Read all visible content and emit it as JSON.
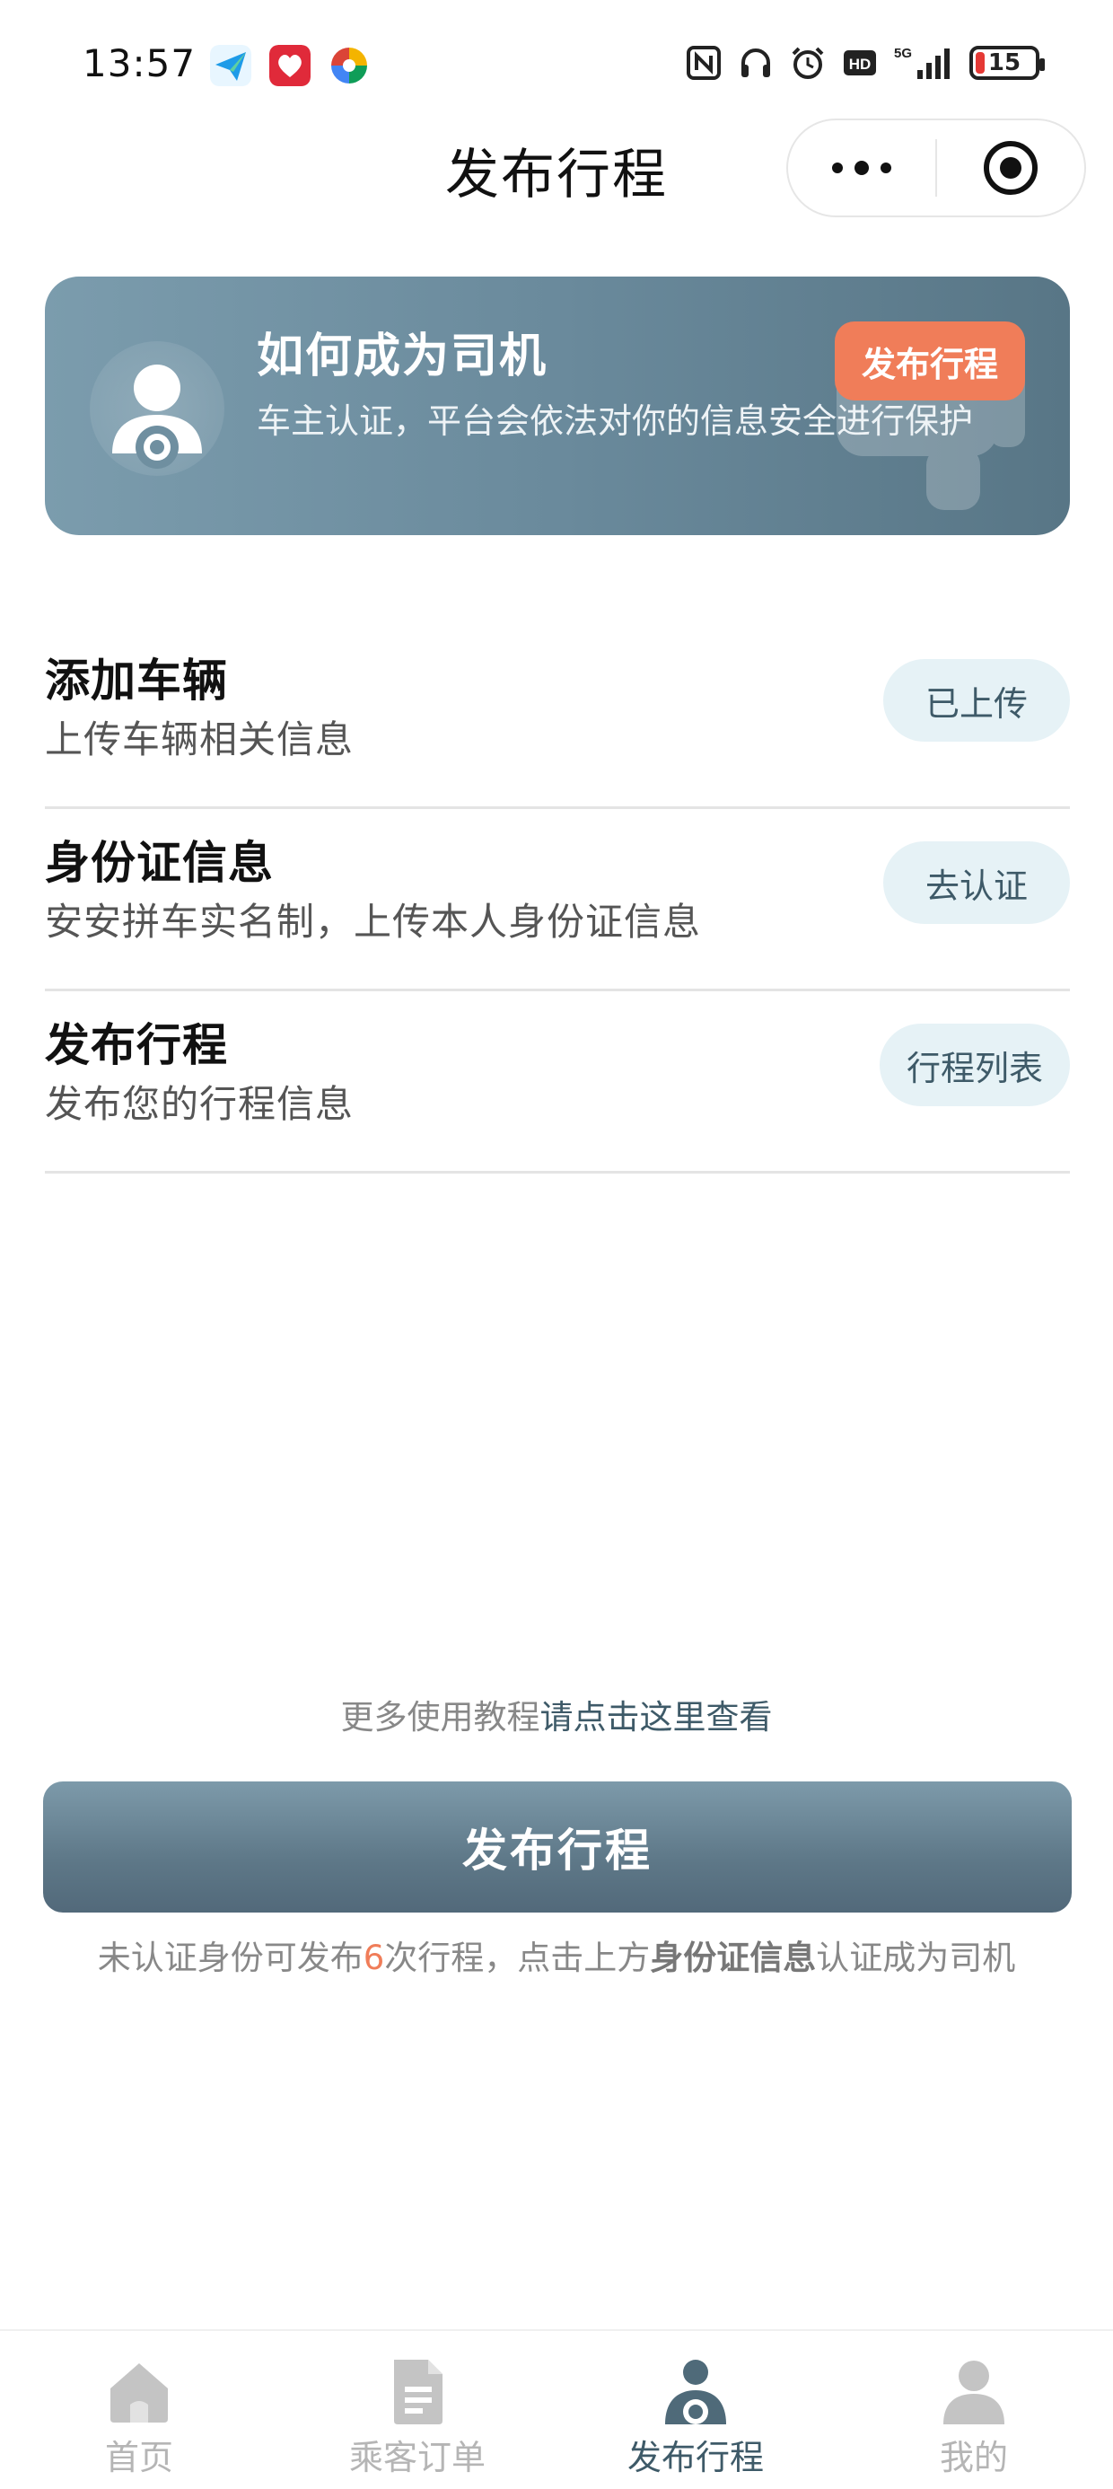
{
  "status_bar": {
    "time": "13:57",
    "battery": "15",
    "icons": [
      "nfc-icon",
      "headphones-icon",
      "alarm-icon",
      "hd-icon",
      "5g-signal-icon",
      "battery-icon"
    ]
  },
  "header": {
    "title": "发布行程"
  },
  "banner": {
    "title": "如何成为司机",
    "description": "车主认证，平台会依法对你的信息安全进行保护",
    "button_label": "发布行程"
  },
  "steps": [
    {
      "title": "添加车辆",
      "subtitle": "上传车辆相关信息",
      "action": "已上传"
    },
    {
      "title": "身份证信息",
      "subtitle": "安安拼车实名制，上传本人身份证信息",
      "action": "去认证"
    },
    {
      "title": "发布行程",
      "subtitle": "发布您的行程信息",
      "action": "行程列表"
    }
  ],
  "tutorial": {
    "prefix": "更多使用教程",
    "link": "请点击这里查看"
  },
  "publish_button": "发布行程",
  "notice": {
    "part1": "未认证身份可发布",
    "count": "6",
    "part2": "次行程，点击上方",
    "strong": "身份证信息",
    "part3": "认证成为司机"
  },
  "tabbar": {
    "items": [
      {
        "label": "首页",
        "icon": "home-icon",
        "active": false
      },
      {
        "label": "乘客订单",
        "icon": "document-icon",
        "active": false
      },
      {
        "label": "发布行程",
        "icon": "driver-icon",
        "active": true
      },
      {
        "label": "我的",
        "icon": "person-icon",
        "active": false
      }
    ]
  },
  "colors": {
    "accent": "#5e7888",
    "highlight": "#f07d59",
    "pill_bg": "#e6f2f6"
  }
}
